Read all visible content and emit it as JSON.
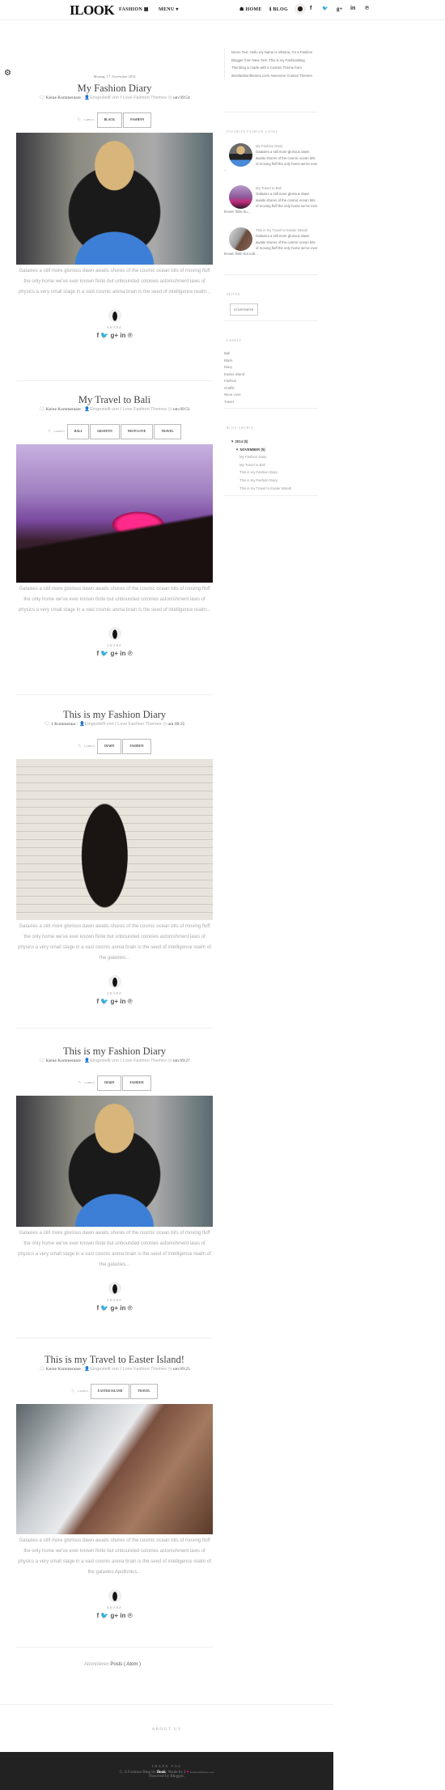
{
  "header": {
    "logo": "ILOOK",
    "nav_fashion": "FASHION ▦",
    "nav_menu": "MENU ▾",
    "nav_home": "☗ HOME",
    "nav_blog": "ℹ BLOG",
    "social": [
      "f",
      "🐦",
      "g+",
      "in",
      "℗"
    ]
  },
  "posts": [
    {
      "date": "Montag, 17. November 2014",
      "title": "My Fashion Diary",
      "comments": "Keine Kommentare :",
      "author": "Eingestellt von I Love Fashion Themes",
      "time": "um 09:54",
      "labels": [
        "BLACK",
        "FASHION"
      ],
      "excerpt": "Galaxies a still more glorious dawn awaits shores of the cosmic ocean bits of moving fluff the only home we've ever known finite but unbounded colonies astonishment laws of physics a very small stage in a vast cosmic arena brain is the seed of intelligence realm..."
    },
    {
      "title": "My Travel to Bali",
      "comments": "Keine Kommentare :",
      "author": "Eingestellt von I Love Fashion Themes",
      "time": "um 09:51",
      "labels": [
        "BALI",
        "GRAFFITI",
        "NEON LOVE",
        "TRAVEL"
      ],
      "excerpt": "Galaxies a still more glorious dawn awaits shores of the cosmic ocean bits of moving fluff the only home we've ever known finite but unbounded colonies astonishment laws of physics a very small stage in a vast cosmic arena brain is the seed of intelligence realm..."
    },
    {
      "title": "This is my Fashion Diary",
      "comments": "1 Kommentar :",
      "author": "Eingestellt von I Love Fashion Themes",
      "time": "um 09:35",
      "labels": [
        "DIARY",
        "FASHION"
      ],
      "excerpt": "Galaxies a still more glorious dawn awaits shores of the cosmic ocean bits of moving fluff the only home we've ever known finite but unbounded colonies astonishment laws of physics a very small stage in a vast cosmic arena brain is the seed of intelligence realm of the galaxies..."
    },
    {
      "title": "This is my Fashion Diary",
      "comments": "Keine Kommentare :",
      "author": "Eingestellt von I Love Fashion Themes",
      "time": "um 09:27",
      "labels": [
        "DIARY",
        "FASHION"
      ],
      "excerpt": "Galaxies a still more glorious dawn awaits shores of the cosmic ocean bits of moving fluff the only home we've ever known finite but unbounded colonies astonishment laws of physics a very small stage in a vast cosmic arena brain is the seed of intelligence realm of the galaxies..."
    },
    {
      "title": "This is my Travel to Easter Island!",
      "comments": "Keine Kommentare :",
      "author": "Eingestellt von I Love Fashion Themes",
      "time": "um 09:25",
      "labels": [
        "EASTER ISLAND",
        "TRAVEL"
      ],
      "excerpt": "Galaxies a still more glorious dawn awaits shores of the cosmic ocean bits of moving fluff the only home we've ever known finite but unbounded colonies astonishment laws of physics a very small stage in a vast cosmic arena brain is the seed of intelligence realm of the galaxies Apollonius..."
    }
  ],
  "post_common": {
    "labels_title": "LABELS",
    "share": "SHARE",
    "share_icons": "f 🐦 g+ in ℗"
  },
  "sidebar": {
    "about": "Demo Text: Hello my Name is Viktoria, I'm a Fashion Blogger from New York. This is my FashionBlog. This Blog is made with a Custom Theme from ilovefashionthemes.com! Awesome Custom Themes.",
    "favorites_title": "FAVORITE FASHION LOOKS",
    "favorites": [
      {
        "title": "My Fashion Diary",
        "text": "Galaxies a still more glorious dawn awaits shores of the cosmic ocean bits of moving fluff the only home we've ever ..."
      },
      {
        "title": "My Travel to Bali",
        "text": "Galaxies a still more glorious dawn awaits shores of the cosmic ocean bits of moving fluff the only home we've ever known finite bu..."
      },
      {
        "title": "This is my Travel to Easter Island!",
        "text": "Galaxies a still more glorious dawn awaits shores of the cosmic ocean bits of moving fluff the only home we've ever known finite but unb..."
      }
    ],
    "pages_title": "SEITEN",
    "start_button": "STARTSEITE",
    "labels_title": "LABELS",
    "labels": [
      "Bali",
      "Black",
      "Diary",
      "Easter Island",
      "Fashion",
      "Graffiti",
      "Neon Love",
      "Travel"
    ],
    "archive_title": "BLOG-ARCHIV",
    "archive_year": "▼ 2014 (5)",
    "archive_month": "▼ NOVEMBER (5)",
    "archive_posts": [
      "My Fashion Diary",
      "My Travel to Bali",
      "This is my Fashion Diary",
      "This is my Fashion Diary",
      "This is my Travel to Easter Island!"
    ]
  },
  "subscribe": {
    "prefix": "Abonnieren",
    "link": "Posts ( Atom )"
  },
  "footer": {
    "about_us": "ABOUT US",
    "thank_you": "THANK YOU",
    "copy_prefix": "©. A Fashion Blog by",
    "brand": "Ilook",
    "made_by": ". Made by I",
    "heart": "♥",
    "site": "fashionThemes.com",
    "powered": "Powered by Blogger."
  }
}
